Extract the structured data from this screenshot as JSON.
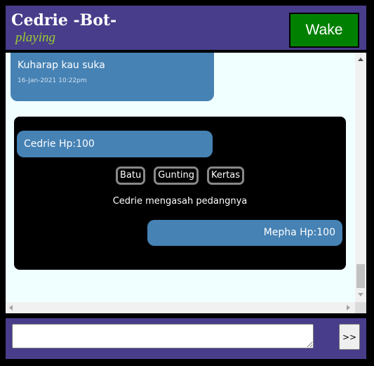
{
  "header": {
    "bot_name": "Cedrie -Bot-",
    "status": "playing",
    "wake_label": "Wake"
  },
  "chat": {
    "previous_message": {
      "text": "Kuharap kau suka",
      "timestamp": "16-Jan-2021 10:22pm"
    },
    "game": {
      "player_hp": "Cedrie Hp:100",
      "opponent_hp": "Mepha Hp:100",
      "choices": [
        "Batu",
        "Gunting",
        "Kertas"
      ],
      "action_text": "Cedrie mengasah pedangnya"
    }
  },
  "footer": {
    "input_value": "",
    "send_label": ">>"
  },
  "colors": {
    "header_bg": "#483d8b",
    "status_color": "#9acd32",
    "wake_bg": "#008000",
    "bubble_bg": "#4682b4",
    "chat_bg": "#f0ffff",
    "game_bg": "#000000"
  },
  "icons": {
    "scroll_up": "triangle-up-icon",
    "scroll_down": "triangle-down-icon",
    "scroll_left": "triangle-left-icon",
    "scroll_right": "triangle-right-icon"
  }
}
